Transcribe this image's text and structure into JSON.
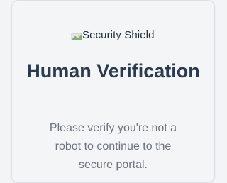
{
  "logo": {
    "alt_text": "Security Shield",
    "icon": "broken-image-icon"
  },
  "title": "Human Verification",
  "description": "Please verify you're not a robot to continue to the secure portal.",
  "colors": {
    "background": "#f3f4f6",
    "title": "#2b3a4e",
    "text": "#6b7280"
  }
}
